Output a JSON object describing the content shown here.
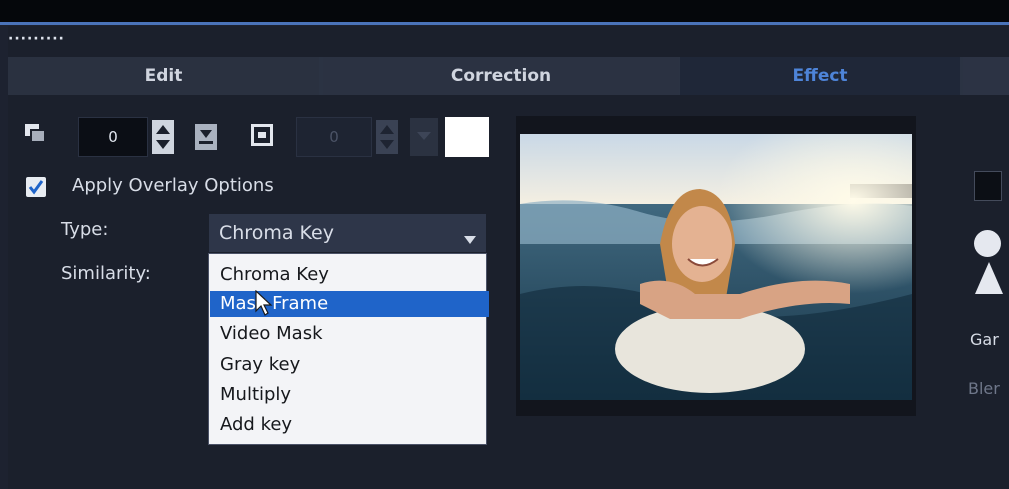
{
  "tabs": [
    {
      "label": "Edit"
    },
    {
      "label": "Correction"
    },
    {
      "label": "Effect"
    }
  ],
  "toolbar": {
    "value_1": "0",
    "value_2": "0"
  },
  "overlay": {
    "apply_label": "Apply Overlay Options",
    "type_label": "Type:",
    "type_value": "Chroma Key",
    "similarity_label": "Similarity:"
  },
  "dropdown": {
    "options": [
      "Chroma Key",
      "Mask Frame",
      "Video Mask",
      "Gray key",
      "Multiply",
      "Add key"
    ],
    "highlighted": "Mask Frame"
  },
  "side": {
    "gamma_label": "Gar",
    "blend_label": "Bler"
  },
  "colors": {
    "accent": "#4e84d8",
    "selection": "#1f64c9"
  }
}
